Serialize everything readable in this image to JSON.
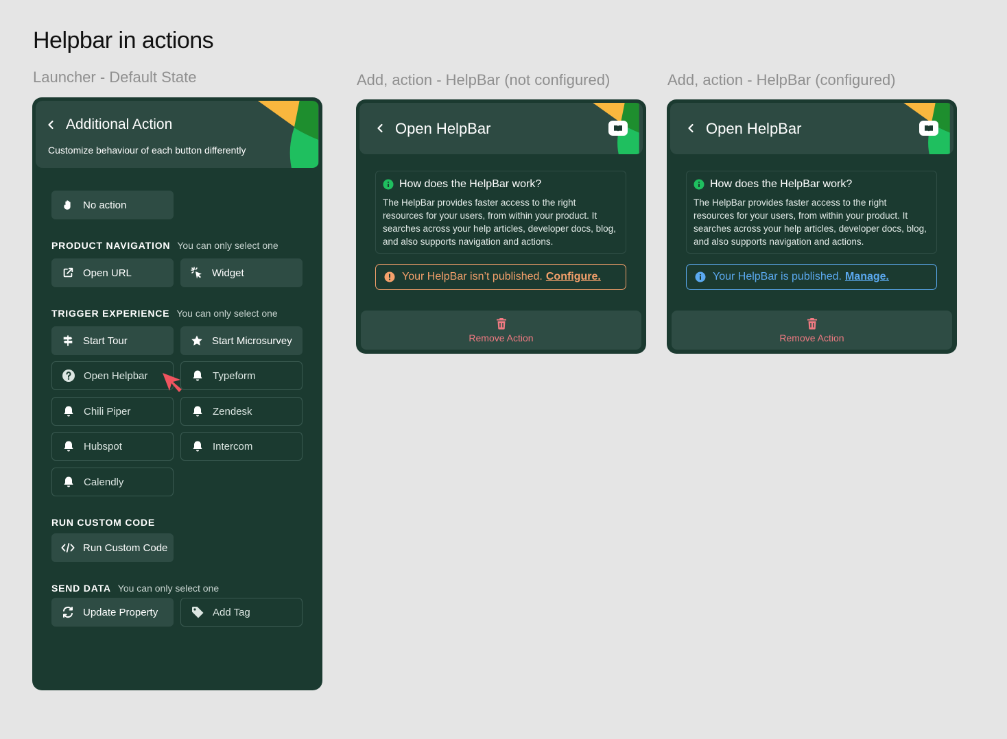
{
  "page": {
    "title": "Helpbar in actions"
  },
  "sections": {
    "launcher": "Launcher - Default State",
    "not_configured": "Add, action - HelpBar (not configured)",
    "configured": "Add, action - HelpBar (configured)"
  },
  "launcher_panel": {
    "header_title": "Additional Action",
    "header_subtitle": "Customize behaviour of each button differently",
    "no_action": "No action",
    "groups": {
      "product_navigation": {
        "label": "PRODUCT NAVIGATION",
        "note": "You can only select one"
      },
      "trigger_experience": {
        "label": "TRIGGER EXPERIENCE",
        "note": "You can only select one"
      },
      "run_custom_code": {
        "label": "RUN CUSTOM CODE"
      },
      "send_data": {
        "label": "SEND DATA",
        "note": "You can only select one"
      }
    },
    "buttons": {
      "open_url": "Open URL",
      "widget": "Widget",
      "start_tour": "Start Tour",
      "start_microsurvey": "Start Microsurvey",
      "open_helpbar": "Open Helpbar",
      "typeform": "Typeform",
      "chili_piper": "Chili Piper",
      "zendesk": "Zendesk",
      "hubspot": "Hubspot",
      "intercom": "Intercom",
      "calendly": "Calendly",
      "run_custom_code": "Run Custom Code",
      "update_property": "Update Property",
      "add_tag": "Add Tag"
    }
  },
  "helpbar_panel": {
    "header_title": "Open HelpBar",
    "info_title": "How does the HelpBar work?",
    "info_body": "The HelpBar provides faster access to the right resources for your users, from within your product. It searches across your help articles, developer docs, blog, and also supports navigation and actions.",
    "not_published_text": "Your HelpBar isn’t published.",
    "configure_link": "Configure.",
    "published_text": "Your HelpBar is published.",
    "manage_link": "Manage.",
    "remove_label": "Remove Action"
  },
  "colors": {
    "page_bg": "#e5e5e5",
    "panel_bg": "#1b3a30",
    "card_bg": "#2e4c44",
    "warn": "#f4a06b",
    "info": "#5ba9ef",
    "danger": "#f07a82",
    "accent_green": "#1fbf5f",
    "accent_yellow": "#f9b73e"
  },
  "icons": [
    "chevron-left-icon",
    "hand-icon",
    "external-link-icon",
    "cursor-click-icon",
    "signpost-icon",
    "star-icon",
    "question-circle-icon",
    "bell-icon",
    "code-icon",
    "refresh-icon",
    "tag-icon",
    "book-icon",
    "info-icon",
    "alert-icon",
    "trash-icon",
    "pointer-arrow-icon"
  ]
}
